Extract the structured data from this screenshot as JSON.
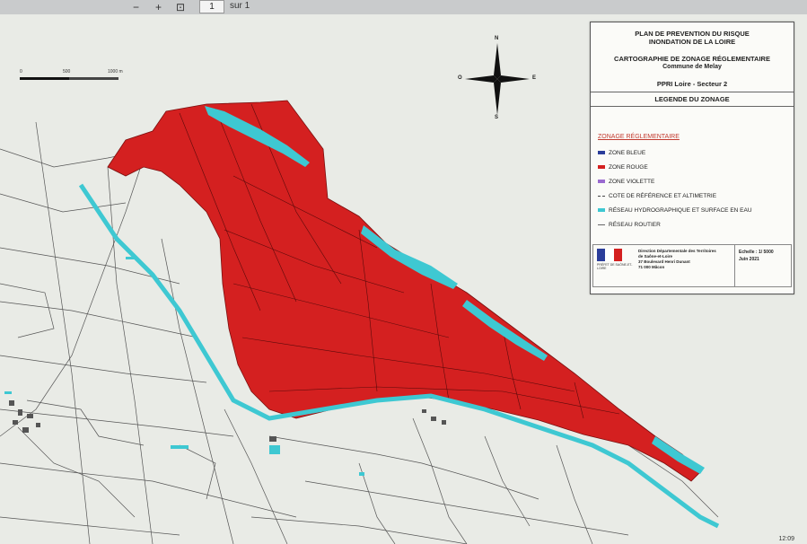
{
  "viewer": {
    "minus": "−",
    "plus": "+",
    "fit": "⊡",
    "page": "1",
    "of": "sur 1"
  },
  "scale": {
    "zero": "0",
    "mid": "500",
    "end": "1000 m"
  },
  "compass": {
    "n": "N",
    "s": "S",
    "e": "E",
    "o": "O"
  },
  "panel": {
    "title1": "PLAN DE PREVENTION DU RISQUE",
    "title2": "INONDATION DE LA LOIRE",
    "title3": "CARTOGRAPHIE DE ZONAGE RÉGLEMENTAIRE",
    "title4": "Commune de Melay",
    "title5": "PPRI Loire - Secteur 2",
    "legend_heading": "LEGENDE DU ZONAGE",
    "section": "ZONAGE RÉGLEMENTAIRE",
    "items": [
      {
        "label": "ZONE BLEUE",
        "color": "#2b3d9a"
      },
      {
        "label": "ZONE ROUGE",
        "color": "#d42020"
      },
      {
        "label": "ZONE VIOLETTE",
        "color": "#9a6ad0"
      },
      {
        "label": "COTE DE RÉFÉRENCE ET ALTIMETRIE",
        "color": "#444444"
      },
      {
        "label": "RÉSEAU HYDROGRAPHIQUE ET SURFACE EN EAU",
        "color": "#3ec8d2"
      },
      {
        "label": "RÉSEAU ROUTIER",
        "color": "#666666"
      }
    ],
    "footer": {
      "ministry": "PRÉFET DE SAÔNE-ET-LOIRE",
      "addr1": "Direction Départementale des Territoires",
      "addr2": "de Saône-et-Loire",
      "addr3": "37 Boulevard Henri Dunant",
      "addr4": "71 000 Mâcon",
      "scale": "Echelle : 1/ 5000",
      "date": "Juin 2021"
    }
  },
  "clock": "12:09",
  "colors": {
    "red_zone": "#d42020",
    "water": "#3ec8d2",
    "road": "#555555"
  }
}
